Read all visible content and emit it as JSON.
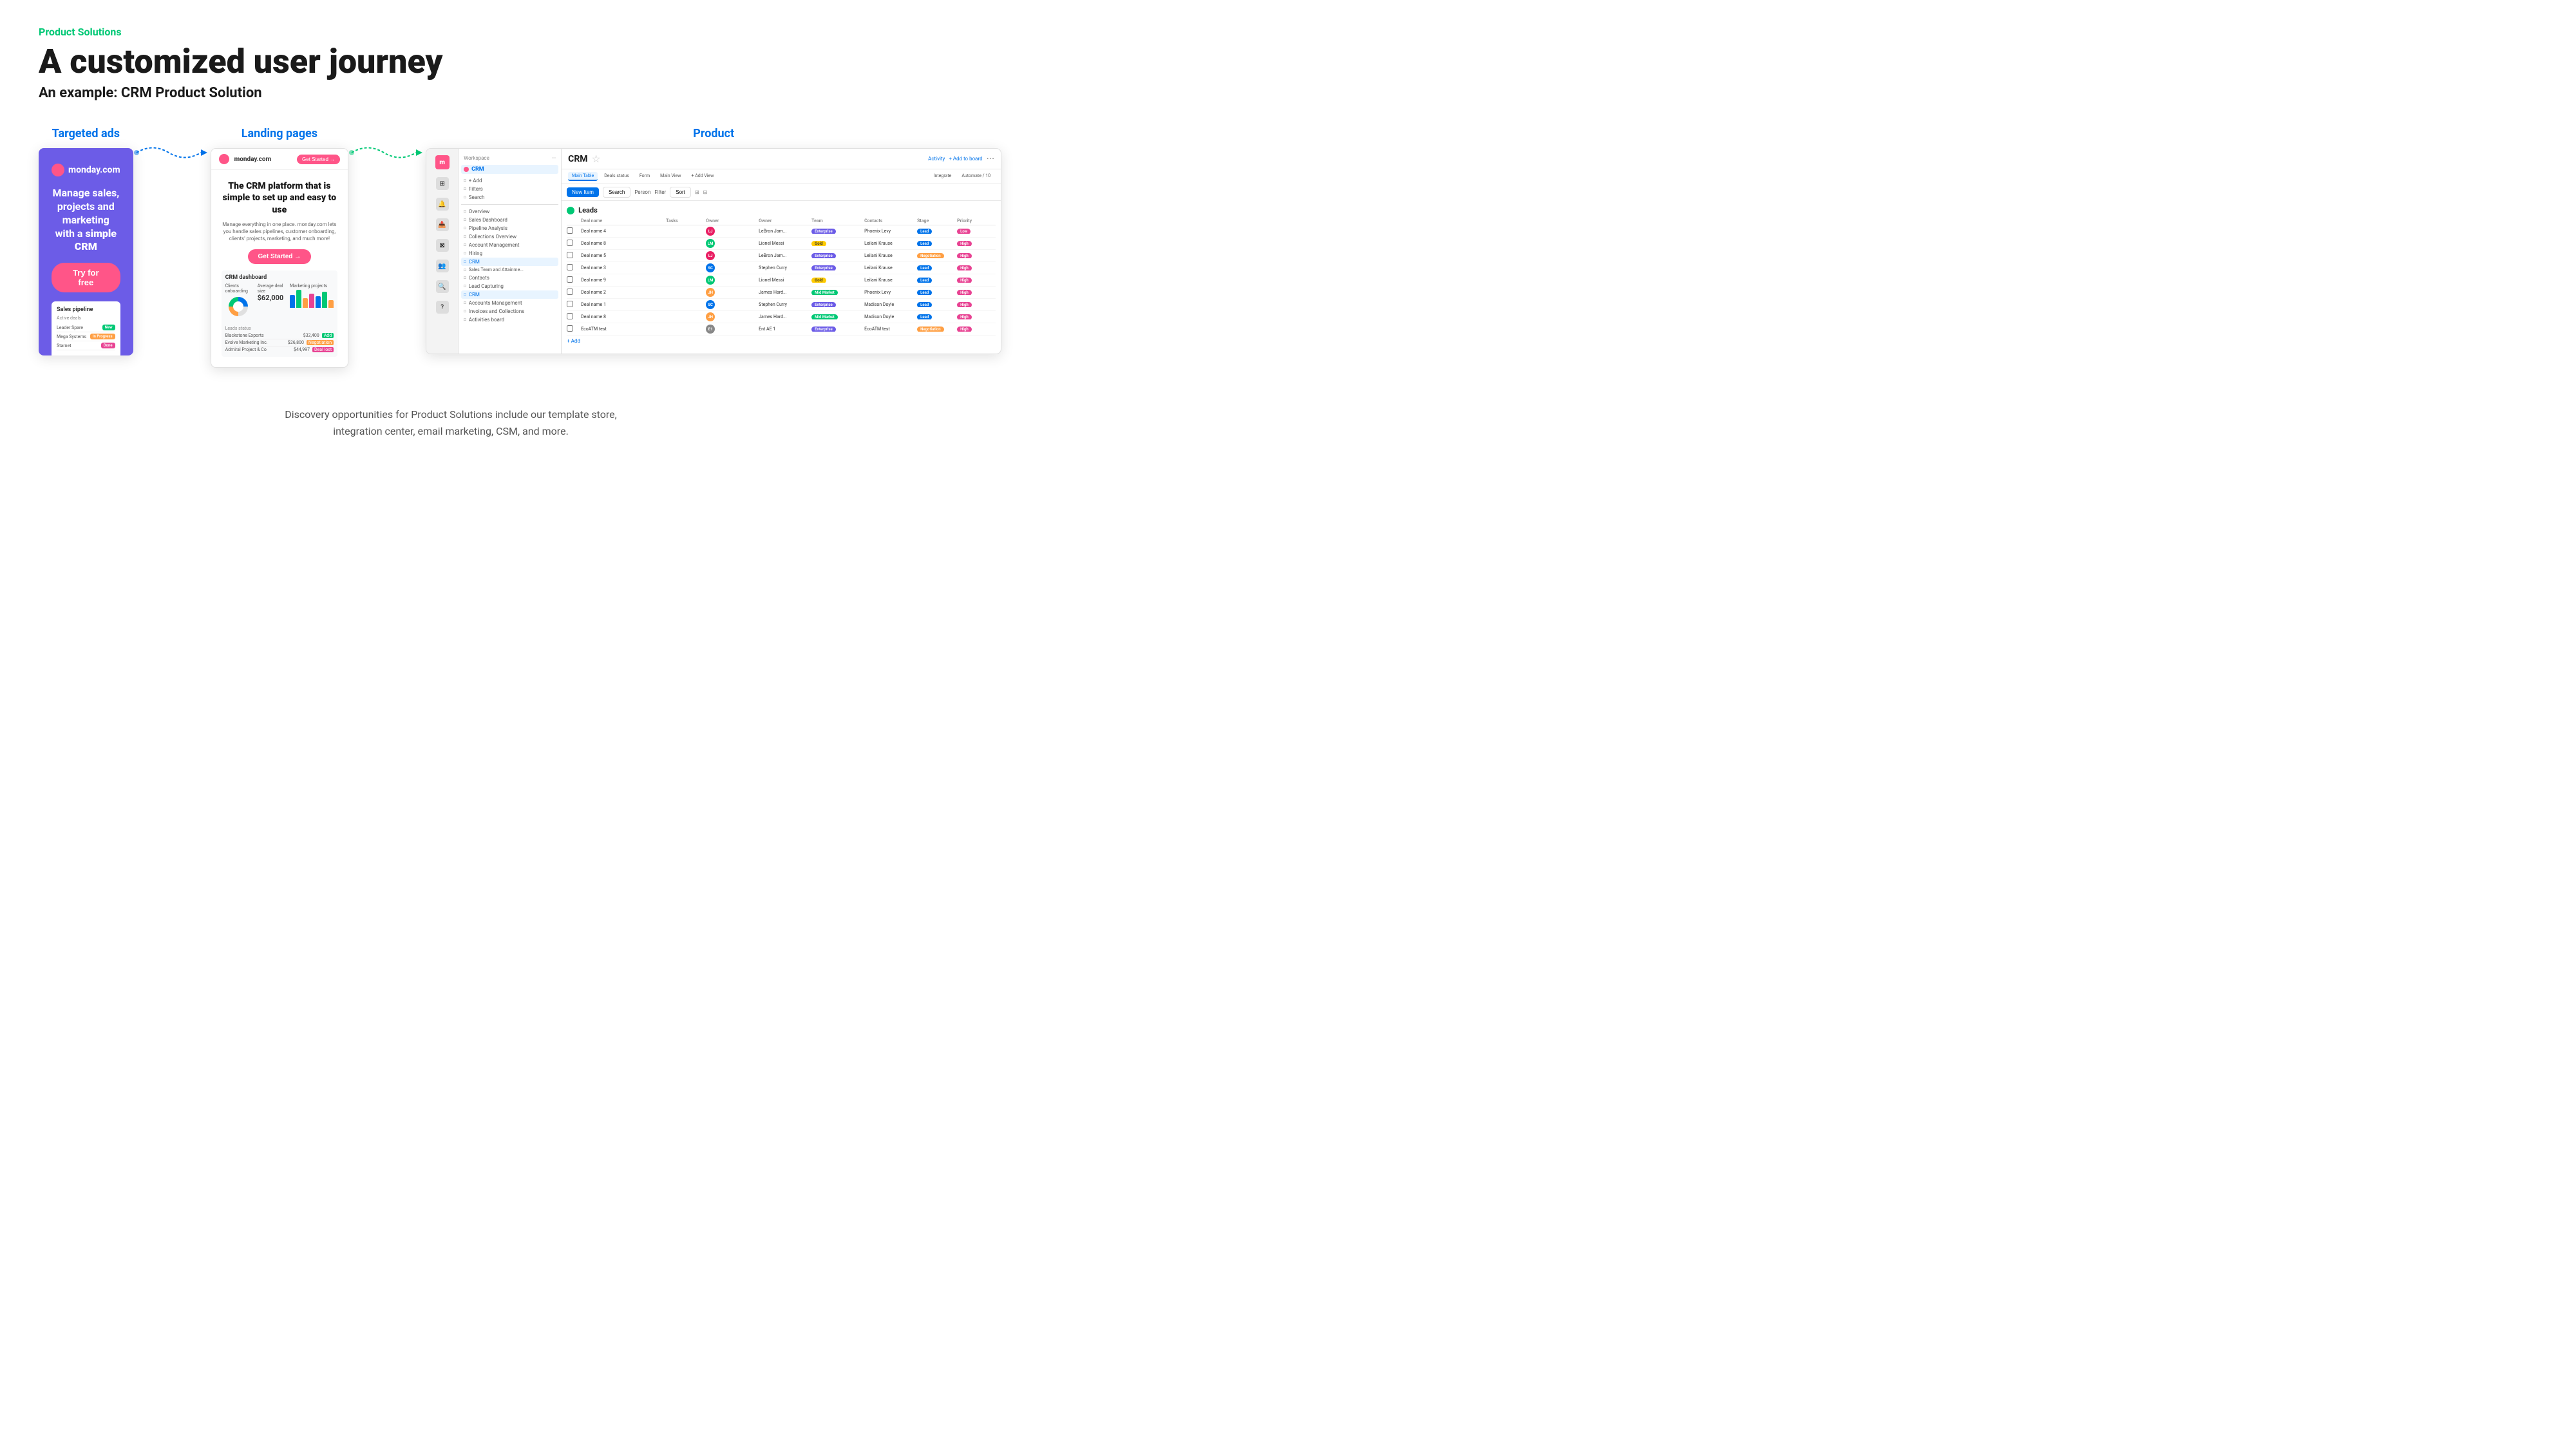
{
  "header": {
    "product_solutions_label": "Product Solutions",
    "main_title": "A customized user journey",
    "sub_title": "An example: CRM Product Solution"
  },
  "flow": {
    "step1_label": "Targeted ads",
    "step2_label": "Landing pages",
    "step3_label": "Product"
  },
  "ad": {
    "logo_text": "monday.com",
    "headline": "Manage sales, projects and marketing with a simple CRM",
    "cta": "Try for free",
    "mini_title": "Sales pipeline",
    "mini_subtitle": "Active deals",
    "rows": [
      {
        "name": "Leader Spare",
        "badge": "New",
        "color": "green"
      },
      {
        "name": "Mega Systems",
        "badge": "In Progress",
        "color": "orange"
      },
      {
        "name": "Starnet",
        "badge": "Done",
        "color": "red"
      }
    ]
  },
  "landing": {
    "logo_text": "monday.com",
    "headline": "The CRM platform that is simple to set up and easy to use",
    "description": "Manage everything in one place. monday.com lets you handle sales pipelines, customer onboarding, clients' projects, marketing, and much more!",
    "cta": "Get Started →",
    "dashboard_title": "CRM dashboard",
    "clients_label": "Clients onboarding",
    "avg_deal_label": "Average deal size",
    "avg_deal_value": "$62,000",
    "marketing_label": "Marketing projects"
  },
  "product": {
    "workspace_label": "Workspace",
    "crm_label": "CRM",
    "activity_label": "Activity",
    "add_to_board_label": "+ Add to board",
    "crm_title": "CRM",
    "toolbar": {
      "new_item": "New Item",
      "search": "Search",
      "sort": "Sort"
    },
    "view_tabs": [
      "Main Table",
      "Deals status",
      "Form",
      "Main View",
      "+ Add View",
      "Integrate",
      "Automate / 10"
    ],
    "nav_items": [
      "Overview",
      "Sales Dashboard",
      "Pipeline Analysis",
      "Collections Overview",
      "Account Management",
      "Hiring",
      "CRM",
      "Sales Team and Attainme...",
      "Contacts",
      "Lead Capturing",
      "CRM",
      "Accounts Management",
      "Invoices and Collections",
      "Activities board"
    ],
    "leads_section": "Leads",
    "table_headers": [
      "",
      "Deal name",
      "Tasks",
      "Owner",
      "Owner",
      "Team",
      "Contacts",
      "Stage",
      "Priority"
    ],
    "rows": [
      {
        "deal": "Deal name 4",
        "owner1": "LeBron Jam...",
        "owner2": "",
        "team": "Enterprise",
        "contact": "Phoenix Levy",
        "stage": "Lead",
        "stage_color": "#0073ea",
        "priority": "Low",
        "priority_color": "#e84393"
      },
      {
        "deal": "Deal name 8",
        "owner1": "Lionel Messi",
        "owner2": "",
        "team": "Gold",
        "team_color": "#ffcb00",
        "contact": "Leilani Krause",
        "stage": "Lead",
        "stage_color": "#0073ea",
        "priority": "High",
        "priority_color": "#e84393"
      },
      {
        "deal": "Deal name 5",
        "owner1": "LeBron Jam...",
        "owner2": "",
        "team": "Enterprise",
        "contact": "Leilani Krause",
        "stage": "Negotiation",
        "stage_color": "#ff9f43",
        "priority": "High",
        "priority_color": "#e84393"
      },
      {
        "deal": "Deal name 3",
        "owner1": "Stephen Curry",
        "owner2": "",
        "team": "Enterprise",
        "contact": "Leilani Krause",
        "stage": "Lead",
        "stage_color": "#0073ea",
        "priority": "High",
        "priority_color": "#e84393"
      },
      {
        "deal": "Deal name 9",
        "owner1": "Lionel Messi",
        "owner2": "",
        "team": "Gold",
        "team_color": "#ffcb00",
        "contact": "Leilani Krause",
        "stage": "Lead",
        "stage_color": "#0073ea",
        "priority": "High",
        "priority_color": "#e84393"
      },
      {
        "deal": "Deal name 2",
        "owner1": "James Hard...",
        "owner2": "",
        "team": "Mid Market",
        "team_color": "#00c875",
        "contact": "Phoenix Levy",
        "stage": "Lead",
        "stage_color": "#0073ea",
        "priority": "High",
        "priority_color": "#e84393"
      },
      {
        "deal": "Deal name 1",
        "owner1": "Stephen Curry",
        "owner2": "",
        "team": "Enterprise",
        "contact": "Madison Doyle",
        "stage": "Lead",
        "stage_color": "#0073ea",
        "priority": "High",
        "priority_color": "#e84393"
      },
      {
        "deal": "Deal name 8",
        "owner1": "James Hard...",
        "owner2": "",
        "team": "Mid Market",
        "team_color": "#00c875",
        "contact": "Madison Doyle",
        "stage": "Lead",
        "stage_color": "#0073ea",
        "priority": "High",
        "priority_color": "#e84393"
      },
      {
        "deal": "EcoATM test",
        "owner1": "Ent AE 1",
        "owner2": "",
        "team": "Enterprise",
        "contact": "EcoATM test",
        "stage": "Negotiation",
        "stage_color": "#ff9f43",
        "priority": "High",
        "priority_color": "#e84393"
      }
    ]
  },
  "footer": {
    "text": "Discovery opportunities for Product Solutions include our template store,\nintegration center, email marketing, CSM, and more."
  }
}
